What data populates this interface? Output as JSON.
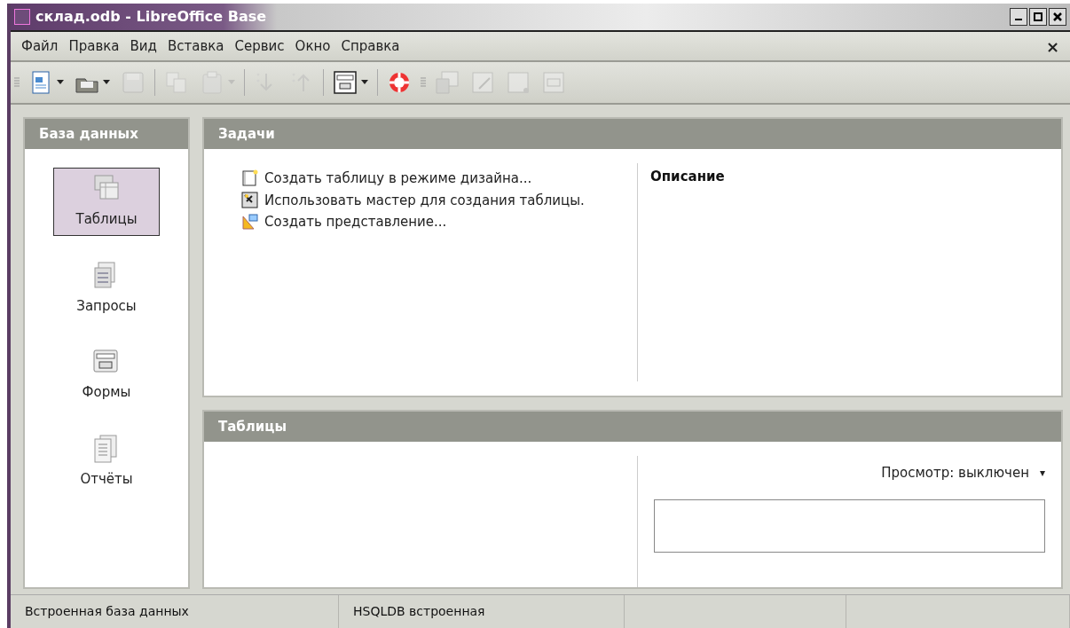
{
  "window": {
    "title": "склад.odb - LibreOffice Base"
  },
  "menu": [
    {
      "label": "Файл"
    },
    {
      "label": "Правка"
    },
    {
      "label": "Вид"
    },
    {
      "label": "Вставка"
    },
    {
      "label": "Сервис"
    },
    {
      "label": "Окно"
    },
    {
      "label": "Справка"
    }
  ],
  "menu_close": "×",
  "toolbar": [
    {
      "kind": "grip"
    },
    {
      "kind": "new",
      "disabled": false,
      "dropdown": true
    },
    {
      "kind": "open",
      "disabled": false,
      "dropdown": true
    },
    {
      "kind": "save",
      "disabled": true,
      "dropdown": false
    },
    {
      "kind": "sep"
    },
    {
      "kind": "copy",
      "disabled": true,
      "dropdown": false
    },
    {
      "kind": "paste",
      "disabled": true,
      "dropdown": true
    },
    {
      "kind": "sep"
    },
    {
      "kind": "sortdown",
      "disabled": true,
      "dropdown": false
    },
    {
      "kind": "sortup",
      "disabled": true,
      "dropdown": false
    },
    {
      "kind": "sep"
    },
    {
      "kind": "form",
      "disabled": false,
      "dropdown": true
    },
    {
      "kind": "sep"
    },
    {
      "kind": "help",
      "disabled": false,
      "dropdown": false
    },
    {
      "kind": "grip"
    },
    {
      "kind": "openobj",
      "disabled": true,
      "dropdown": false
    },
    {
      "kind": "edit",
      "disabled": true,
      "dropdown": false
    },
    {
      "kind": "delete",
      "disabled": true,
      "dropdown": false
    },
    {
      "kind": "rename",
      "disabled": true,
      "dropdown": false
    }
  ],
  "sidebar": {
    "title": "База данных",
    "items": [
      {
        "label": "Таблицы",
        "kind": "tables",
        "selected": true
      },
      {
        "label": "Запросы",
        "kind": "queries",
        "selected": false
      },
      {
        "label": "Формы",
        "kind": "forms",
        "selected": false
      },
      {
        "label": "Отчёты",
        "kind": "reports",
        "selected": false
      }
    ]
  },
  "tasks": {
    "title": "Задачи",
    "items": [
      {
        "label": "Создать таблицу в режиме дизайна...",
        "kind": "design"
      },
      {
        "label": "Использовать мастер для создания таблицы.",
        "kind": "wizard"
      },
      {
        "label": "Создать представление...",
        "kind": "view"
      }
    ],
    "description_title": "Описание"
  },
  "objects": {
    "title": "Таблицы",
    "preview": "Просмотр: выключен",
    "preview_caret": "▾"
  },
  "status_bar": [
    "Встроенная база данных",
    "HSQLDB встроенная"
  ]
}
